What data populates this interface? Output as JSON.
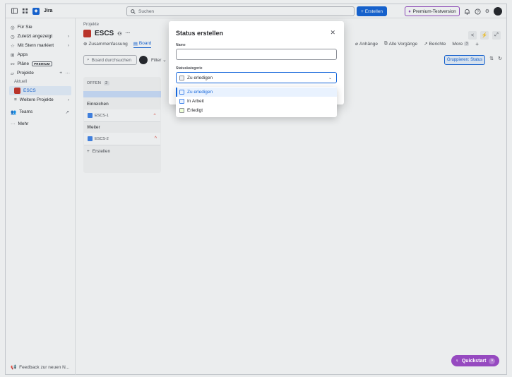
{
  "topbar": {
    "app_name": "Jira",
    "search_placeholder": "Suchen",
    "create_label": "Erstellen",
    "premium_label": "Premium-Testversion"
  },
  "sidebar": {
    "items": [
      {
        "label": "Für Sie"
      },
      {
        "label": "Zuletzt angezeigt"
      },
      {
        "label": "Mit Stern markiert"
      },
      {
        "label": "Apps"
      },
      {
        "label": "Pläne",
        "badge": "PREMIUM"
      },
      {
        "label": "Projekte"
      }
    ],
    "recent_heading": "Aktuell",
    "active_project": "ESCS",
    "more_projects": "Weitere Projekte",
    "teams": "Teams",
    "more": "Mehr",
    "feedback": "Feedback zur neuen N..."
  },
  "project": {
    "breadcrumb": "Projekte",
    "name": "ESCS",
    "tabs": [
      "Zusammenfassung",
      "Board"
    ],
    "tabs_right": [
      "Anhänge",
      "Alle Vorgänge",
      "Berichte"
    ],
    "more_label": "More",
    "more_count": "3"
  },
  "board": {
    "search_placeholder": "Board durchsuchen",
    "filter_label": "Filter",
    "group_label": "Gruppieren: Status",
    "column": {
      "title": "OFFEN",
      "count": "2",
      "groups": [
        {
          "label": "Einreichen",
          "card": "ESCS-1"
        },
        {
          "label": "Weiter",
          "card": "ESCS-2"
        }
      ],
      "add_label": "Erstellen"
    }
  },
  "modal": {
    "title": "Status erstellen",
    "name_label": "Name",
    "name_value": "",
    "category_label": "Statuskategorie",
    "category_value": "Zu erledigen",
    "options": [
      "Zu erledigen",
      "In Arbeit",
      "Erledigt"
    ]
  },
  "quickstart_label": "Quickstart",
  "colors": {
    "accent": "#1868db",
    "premium": "#964ac0",
    "project": "#c9372c"
  }
}
